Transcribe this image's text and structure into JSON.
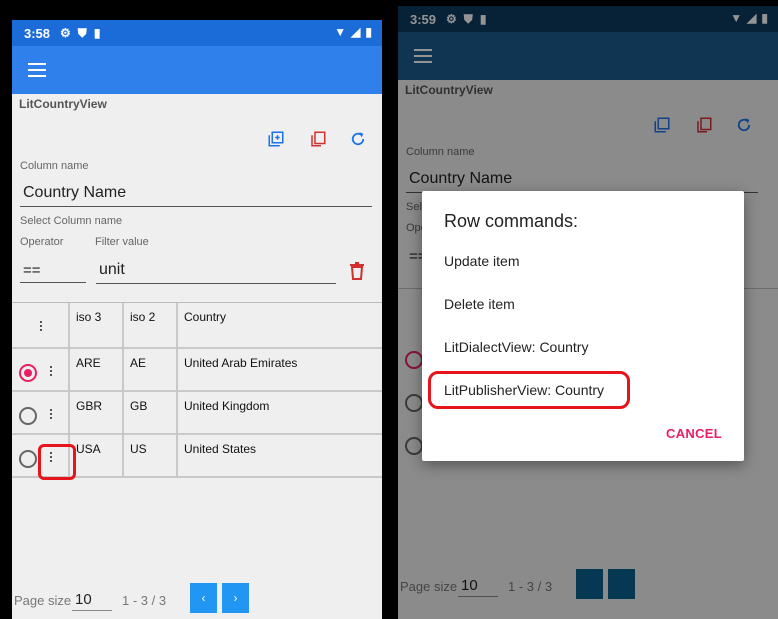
{
  "colors": {
    "appbar_left": "#2f80ea",
    "appbar_right": "#1a5c90",
    "status_left": "#1b6cd8",
    "status_right": "#0d3a5e",
    "accent": "#e91e63",
    "toolbar_icon": "#1a73e8",
    "delete_red": "#d32f2f",
    "pager_left": "#2196f3",
    "pager_right": "#0b6190"
  },
  "left_screen": {
    "status": {
      "time": "3:58",
      "icons": [
        "settings-icon",
        "shield-icon",
        "sim-card-icon"
      ],
      "right_icons": [
        "wifi-icon",
        "signal-icon",
        "battery-icon"
      ]
    },
    "view_title": "LitCountryView",
    "toolbar": [
      "add-multiple-icon",
      "copy-icon",
      "refresh-icon"
    ],
    "column_field": {
      "label": "Column name",
      "value": "Country Name",
      "helper": "Select Column name"
    },
    "operator_field": {
      "label": "Operator",
      "value": "=="
    },
    "filter_field": {
      "label": "Filter value",
      "value": "unit"
    },
    "grid": {
      "columns": [
        "iso 3",
        "iso 2",
        "Country"
      ],
      "rows": [
        {
          "iso3": "ARE",
          "iso2": "AE",
          "country": "United Arab Emirates",
          "selected": true
        },
        {
          "iso3": "GBR",
          "iso2": "GB",
          "country": "United Kingdom",
          "selected": false
        },
        {
          "iso3": "USA",
          "iso2": "US",
          "country": "United States",
          "selected": false
        }
      ]
    },
    "pager": {
      "label": "Page size",
      "size": "10",
      "range": "1 - 3 / 3",
      "prev": "‹",
      "next": "›"
    }
  },
  "right_screen": {
    "status": {
      "time": "3:59"
    },
    "view_title": "LitCountryView",
    "column_field": {
      "label": "Column name",
      "value": "Country Name",
      "helper_trunc": "Sele",
      "op_trunc": "Ope",
      "op_value": "=="
    },
    "pager": {
      "label": "Page size",
      "size": "10",
      "range": "1 - 3 / 3"
    },
    "dialog": {
      "title": "Row commands:",
      "items": [
        "Update item",
        "Delete item",
        "LitDialectView: Country",
        "LitPublisherView: Country"
      ],
      "cancel": "CANCEL"
    }
  }
}
